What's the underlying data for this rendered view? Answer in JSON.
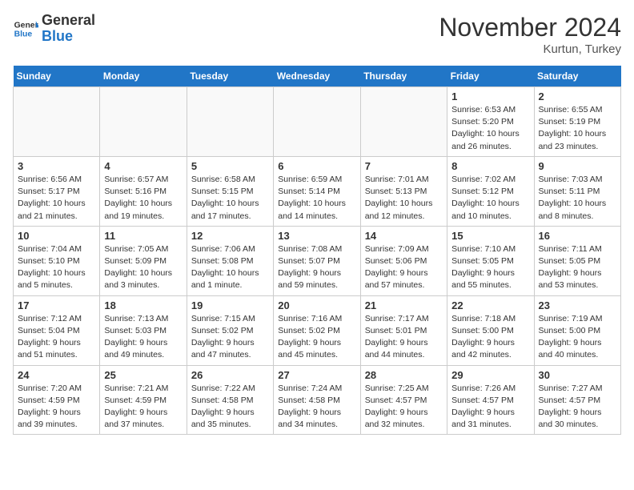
{
  "header": {
    "logo_general": "General",
    "logo_blue": "Blue",
    "month_title": "November 2024",
    "location": "Kurtun, Turkey"
  },
  "weekdays": [
    "Sunday",
    "Monday",
    "Tuesday",
    "Wednesday",
    "Thursday",
    "Friday",
    "Saturday"
  ],
  "weeks": [
    [
      {
        "day": "",
        "info": ""
      },
      {
        "day": "",
        "info": ""
      },
      {
        "day": "",
        "info": ""
      },
      {
        "day": "",
        "info": ""
      },
      {
        "day": "",
        "info": ""
      },
      {
        "day": "1",
        "info": "Sunrise: 6:53 AM\nSunset: 5:20 PM\nDaylight: 10 hours and 26 minutes."
      },
      {
        "day": "2",
        "info": "Sunrise: 6:55 AM\nSunset: 5:19 PM\nDaylight: 10 hours and 23 minutes."
      }
    ],
    [
      {
        "day": "3",
        "info": "Sunrise: 6:56 AM\nSunset: 5:17 PM\nDaylight: 10 hours and 21 minutes."
      },
      {
        "day": "4",
        "info": "Sunrise: 6:57 AM\nSunset: 5:16 PM\nDaylight: 10 hours and 19 minutes."
      },
      {
        "day": "5",
        "info": "Sunrise: 6:58 AM\nSunset: 5:15 PM\nDaylight: 10 hours and 17 minutes."
      },
      {
        "day": "6",
        "info": "Sunrise: 6:59 AM\nSunset: 5:14 PM\nDaylight: 10 hours and 14 minutes."
      },
      {
        "day": "7",
        "info": "Sunrise: 7:01 AM\nSunset: 5:13 PM\nDaylight: 10 hours and 12 minutes."
      },
      {
        "day": "8",
        "info": "Sunrise: 7:02 AM\nSunset: 5:12 PM\nDaylight: 10 hours and 10 minutes."
      },
      {
        "day": "9",
        "info": "Sunrise: 7:03 AM\nSunset: 5:11 PM\nDaylight: 10 hours and 8 minutes."
      }
    ],
    [
      {
        "day": "10",
        "info": "Sunrise: 7:04 AM\nSunset: 5:10 PM\nDaylight: 10 hours and 5 minutes."
      },
      {
        "day": "11",
        "info": "Sunrise: 7:05 AM\nSunset: 5:09 PM\nDaylight: 10 hours and 3 minutes."
      },
      {
        "day": "12",
        "info": "Sunrise: 7:06 AM\nSunset: 5:08 PM\nDaylight: 10 hours and 1 minute."
      },
      {
        "day": "13",
        "info": "Sunrise: 7:08 AM\nSunset: 5:07 PM\nDaylight: 9 hours and 59 minutes."
      },
      {
        "day": "14",
        "info": "Sunrise: 7:09 AM\nSunset: 5:06 PM\nDaylight: 9 hours and 57 minutes."
      },
      {
        "day": "15",
        "info": "Sunrise: 7:10 AM\nSunset: 5:05 PM\nDaylight: 9 hours and 55 minutes."
      },
      {
        "day": "16",
        "info": "Sunrise: 7:11 AM\nSunset: 5:05 PM\nDaylight: 9 hours and 53 minutes."
      }
    ],
    [
      {
        "day": "17",
        "info": "Sunrise: 7:12 AM\nSunset: 5:04 PM\nDaylight: 9 hours and 51 minutes."
      },
      {
        "day": "18",
        "info": "Sunrise: 7:13 AM\nSunset: 5:03 PM\nDaylight: 9 hours and 49 minutes."
      },
      {
        "day": "19",
        "info": "Sunrise: 7:15 AM\nSunset: 5:02 PM\nDaylight: 9 hours and 47 minutes."
      },
      {
        "day": "20",
        "info": "Sunrise: 7:16 AM\nSunset: 5:02 PM\nDaylight: 9 hours and 45 minutes."
      },
      {
        "day": "21",
        "info": "Sunrise: 7:17 AM\nSunset: 5:01 PM\nDaylight: 9 hours and 44 minutes."
      },
      {
        "day": "22",
        "info": "Sunrise: 7:18 AM\nSunset: 5:00 PM\nDaylight: 9 hours and 42 minutes."
      },
      {
        "day": "23",
        "info": "Sunrise: 7:19 AM\nSunset: 5:00 PM\nDaylight: 9 hours and 40 minutes."
      }
    ],
    [
      {
        "day": "24",
        "info": "Sunrise: 7:20 AM\nSunset: 4:59 PM\nDaylight: 9 hours and 39 minutes."
      },
      {
        "day": "25",
        "info": "Sunrise: 7:21 AM\nSunset: 4:59 PM\nDaylight: 9 hours and 37 minutes."
      },
      {
        "day": "26",
        "info": "Sunrise: 7:22 AM\nSunset: 4:58 PM\nDaylight: 9 hours and 35 minutes."
      },
      {
        "day": "27",
        "info": "Sunrise: 7:24 AM\nSunset: 4:58 PM\nDaylight: 9 hours and 34 minutes."
      },
      {
        "day": "28",
        "info": "Sunrise: 7:25 AM\nSunset: 4:57 PM\nDaylight: 9 hours and 32 minutes."
      },
      {
        "day": "29",
        "info": "Sunrise: 7:26 AM\nSunset: 4:57 PM\nDaylight: 9 hours and 31 minutes."
      },
      {
        "day": "30",
        "info": "Sunrise: 7:27 AM\nSunset: 4:57 PM\nDaylight: 9 hours and 30 minutes."
      }
    ]
  ]
}
